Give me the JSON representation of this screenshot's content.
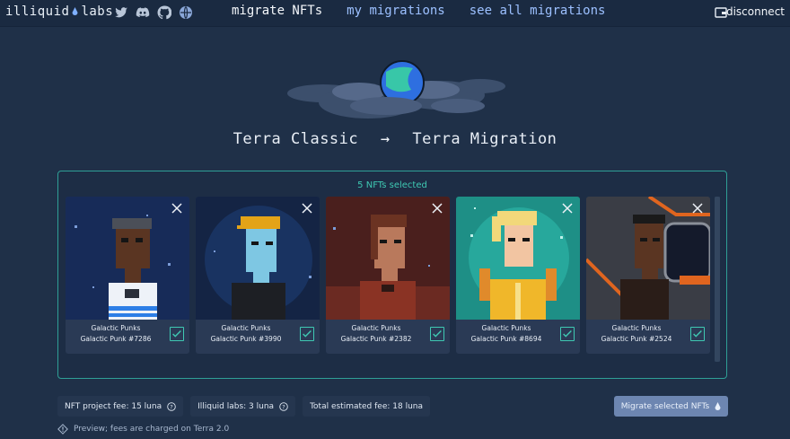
{
  "brand": {
    "left": "illiquid",
    "right": "labs"
  },
  "socials": [
    "twitter-icon",
    "discord-icon",
    "github-icon",
    "terra-station-icon"
  ],
  "nav": [
    {
      "label": "migrate NFTs",
      "active": true
    },
    {
      "label": "my migrations",
      "active": false
    },
    {
      "label": "see all migrations",
      "active": false
    }
  ],
  "header_actions": {
    "disconnect": "disconnect"
  },
  "heading": {
    "from": "Terra Classic",
    "arrow": "→",
    "to": "Terra Migration"
  },
  "panel": {
    "selected_text": "5 NFTs selected"
  },
  "nfts": [
    {
      "collection": "Galactic Punks",
      "name": "Galactic Punk #7286"
    },
    {
      "collection": "Galactic Punks",
      "name": "Galactic Punk #3990"
    },
    {
      "collection": "Galactic Punks",
      "name": "Galactic Punk #2382"
    },
    {
      "collection": "Galactic Punks",
      "name": "Galactic Punk #8694"
    },
    {
      "collection": "Galactic Punks",
      "name": "Galactic Punk #2524"
    }
  ],
  "fees": {
    "project_fee": "NFT project fee: 15 luna",
    "illiquid_fee": "Illiquid labs: 3 luna",
    "total_fee": "Total estimated fee: 18 luna"
  },
  "migrate_button": "Migrate selected NFTs",
  "preview_note": "Preview; fees are charged on Terra 2.0",
  "colors": {
    "background": "#1f3048",
    "accent": "#3fc9b3",
    "link": "#9cc0ff",
    "button": "#6d86b1"
  }
}
